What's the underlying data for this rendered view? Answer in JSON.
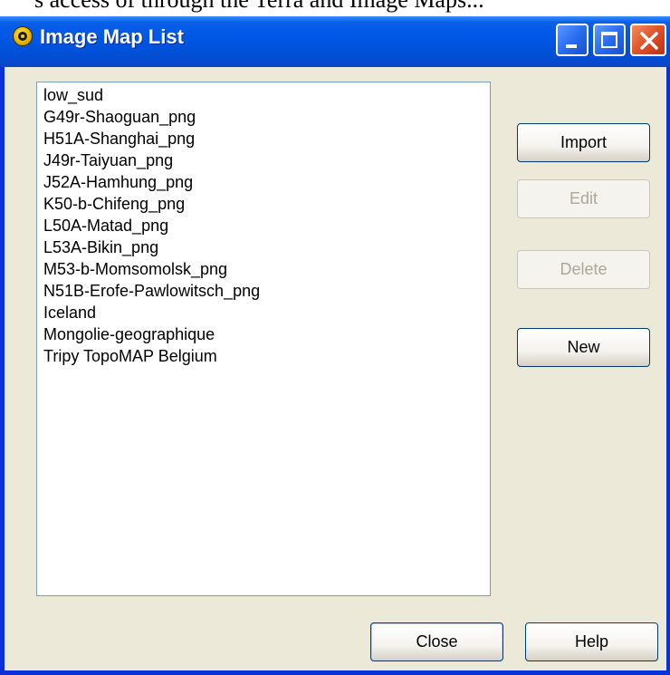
{
  "top_strip": {
    "text": "s access of through the Terra and Image Maps..."
  },
  "window": {
    "title": "Image Map List",
    "icon": "app-logo-icon",
    "controls": {
      "minimize": "minimize-icon",
      "maximize": "maximize-icon",
      "close": "close-icon"
    }
  },
  "map_list": {
    "items": [
      "low_sud",
      "G49r-Shaoguan_png",
      "H51A-Shanghai_png",
      "J49r-Taiyuan_png",
      "J52A-Hamhung_png",
      "K50-b-Chifeng_png",
      "L50A-Matad_png",
      "L53A-Bikin_png",
      "M53-b-Momsomolsk_png",
      "N51B-Erofe-Pawlowitsch_png",
      "Iceland",
      "Mongolie-geographique",
      "Tripy TopoMAP Belgium"
    ]
  },
  "buttons": {
    "import": "Import",
    "edit": "Edit",
    "delete": "Delete",
    "new": "New",
    "close": "Close",
    "help": "Help"
  },
  "colors": {
    "titlebar": "#0058e6",
    "client_bg": "#ece9d8",
    "close_button": "#e0502a",
    "disabled_text": "#aca899"
  }
}
